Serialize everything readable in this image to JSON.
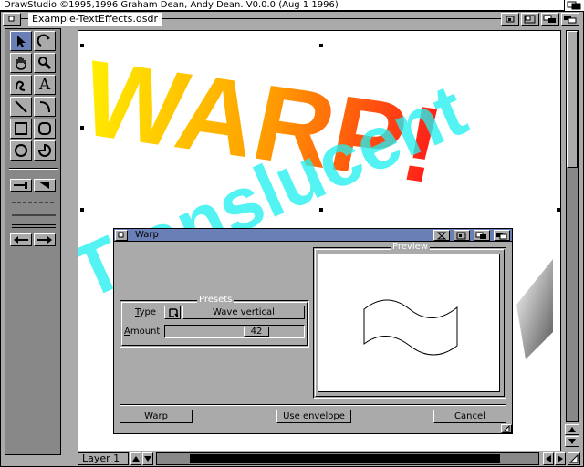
{
  "screen": {
    "title": "DrawStudio ©1995,1996 Graham Dean, Andy Dean. V0.0.0 (Aug  1 1996)"
  },
  "main_window": {
    "title": "Example-TextEffects.dsdr"
  },
  "canvas": {
    "texts": {
      "warp": "WARP!",
      "translucent": "Translucent"
    },
    "colors": {
      "warp_gradient_start": "#ffee00",
      "warp_gradient_end": "#ff1a1a",
      "translucent_fill": "#22f0f0",
      "selection_handle": "#000000"
    }
  },
  "toolbox": {
    "tools": [
      {
        "name": "select-arrow-icon",
        "selected": true
      },
      {
        "name": "rotate-icon",
        "selected": false
      },
      {
        "name": "hand-icon",
        "selected": false
      },
      {
        "name": "magnify-icon",
        "selected": false
      },
      {
        "name": "freehand-icon",
        "selected": false
      },
      {
        "name": "text-icon",
        "selected": false
      },
      {
        "name": "line-icon",
        "selected": false
      },
      {
        "name": "curve-icon",
        "selected": false
      },
      {
        "name": "rectangle-icon",
        "selected": false
      },
      {
        "name": "rounded-rectangle-icon",
        "selected": false
      },
      {
        "name": "ellipse-icon",
        "selected": false
      },
      {
        "name": "pie-icon",
        "selected": false
      }
    ],
    "text_tool_glyph": "A",
    "accent": "#6a7fb6"
  },
  "status": {
    "layer": "Layer 1"
  },
  "warp_dialog": {
    "title": "Warp",
    "presets_group": "Presets",
    "type_label": "Type",
    "type_value": "Wave vertical",
    "amount_label": "Amount",
    "amount_value": "42",
    "preview_group": "Preview",
    "buttons": {
      "warp": "Warp",
      "use_envelope": "Use envelope",
      "cancel": "Cancel"
    }
  }
}
